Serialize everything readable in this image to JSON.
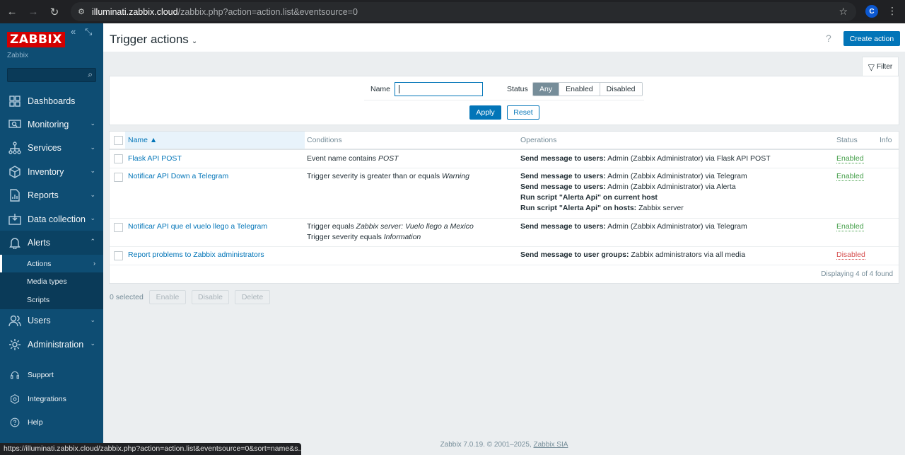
{
  "browser": {
    "url_host": "illuminati.zabbix.cloud",
    "url_path": "/zabbix.php?action=action.list&eventsource=0",
    "profile_initial": "C",
    "status_url": "https://illuminati.zabbix.cloud/zabbix.php?action=action.list&eventsource=0&sort=name&s..."
  },
  "sidebar": {
    "logo": "ZABBIX",
    "subtitle": "Zabbix",
    "menu": [
      {
        "label": "Dashboards",
        "icon": "dashboard-icon"
      },
      {
        "label": "Monitoring",
        "icon": "monitoring-icon"
      },
      {
        "label": "Services",
        "icon": "services-icon"
      },
      {
        "label": "Inventory",
        "icon": "inventory-icon"
      },
      {
        "label": "Reports",
        "icon": "reports-icon"
      },
      {
        "label": "Data collection",
        "icon": "data-collection-icon"
      },
      {
        "label": "Alerts",
        "icon": "bell-icon"
      }
    ],
    "alerts_sub": [
      "Actions",
      "Media types",
      "Scripts"
    ],
    "menu2": [
      {
        "label": "Users",
        "icon": "users-icon"
      },
      {
        "label": "Administration",
        "icon": "gear-icon"
      }
    ],
    "footer_menu": [
      "Support",
      "Integrations",
      "Help"
    ]
  },
  "header": {
    "title": "Trigger actions",
    "help": "?",
    "create_label": "Create action"
  },
  "filter": {
    "tab_label": "Filter",
    "name_label": "Name",
    "name_value": "",
    "status_label": "Status",
    "status_options": [
      "Any",
      "Enabled",
      "Disabled"
    ],
    "status_selected": "Any",
    "apply_label": "Apply",
    "reset_label": "Reset"
  },
  "table": {
    "columns": [
      "Name ▲",
      "Conditions",
      "Operations",
      "Status",
      "Info"
    ],
    "rows": [
      {
        "name": "Flask API POST",
        "conditions": [
          [
            "Event name contains ",
            "POST"
          ]
        ],
        "operations": [
          [
            "Send message to users:",
            " Admin (Zabbix Administrator) via Flask API POST"
          ]
        ],
        "status": "Enabled"
      },
      {
        "name": "Notificar API Down a Telegram",
        "conditions": [
          [
            "Trigger severity is greater than or equals ",
            "Warning"
          ]
        ],
        "operations": [
          [
            "Send message to users:",
            " Admin (Zabbix Administrator) via Telegram"
          ],
          [
            "Send message to users:",
            " Admin (Zabbix Administrator) via Alerta"
          ],
          [
            "Run script \"Alerta Api\" on current host",
            ""
          ],
          [
            "Run script \"Alerta Api\" on hosts:",
            " Zabbix server"
          ]
        ],
        "status": "Enabled"
      },
      {
        "name": "Notificar API que el vuelo llego a Telegram",
        "conditions": [
          [
            "Trigger equals ",
            "Zabbix server: Vuelo llego a Mexico"
          ],
          [
            "Trigger severity equals ",
            "Information"
          ]
        ],
        "operations": [
          [
            "Send message to users:",
            " Admin (Zabbix Administrator) via Telegram"
          ]
        ],
        "status": "Enabled"
      },
      {
        "name": "Report problems to Zabbix administrators",
        "conditions": [],
        "operations": [
          [
            "Send message to user groups:",
            " Zabbix administrators via all media"
          ]
        ],
        "status": "Disabled"
      }
    ],
    "count_text": "Displaying 4 of 4 found"
  },
  "bulk": {
    "selected_text": "0 selected",
    "enable_label": "Enable",
    "disable_label": "Disable",
    "delete_label": "Delete"
  },
  "footer": {
    "text": "Zabbix 7.0.19. © 2001–2025, ",
    "link": "Zabbix SIA"
  }
}
